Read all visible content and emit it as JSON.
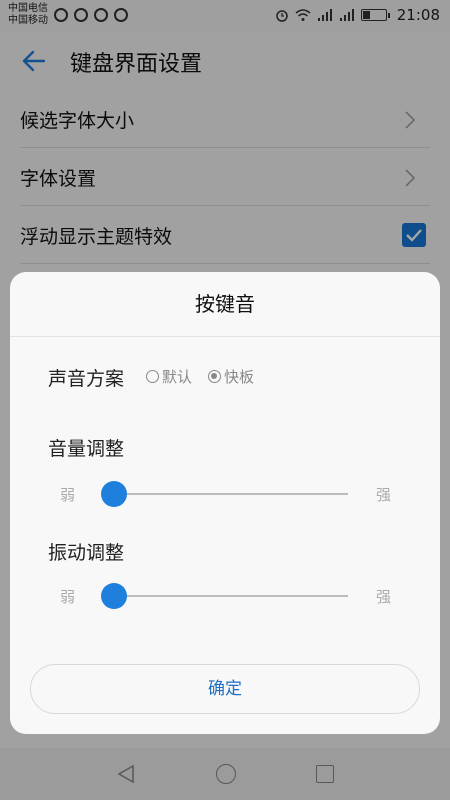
{
  "status_bar": {
    "carrier_1": "中国电信",
    "carrier_2": "中国移动",
    "time": "21:08"
  },
  "app_bar": {
    "title": "键盘界面设置",
    "back_icon": "back-arrow-icon"
  },
  "settings": [
    {
      "label": "候选字体大小",
      "control": "chevron"
    },
    {
      "label": "字体设置",
      "control": "chevron"
    },
    {
      "label": "浮动显示主题特效",
      "control": "checkbox",
      "checked": true
    }
  ],
  "dialog": {
    "title": "按键音",
    "scheme_label": "声音方案",
    "scheme_options": [
      "默认",
      "快板"
    ],
    "scheme_selected": "快板",
    "volume_label": "音量调整",
    "vibration_label": "振动调整",
    "weak_label": "弱",
    "strong_label": "强",
    "volume_level": 0.0,
    "vibration_level": 0.0,
    "confirm_label": "确定"
  },
  "colors": {
    "accent": "#1e7fdd",
    "checkbox": "#1877d8"
  }
}
